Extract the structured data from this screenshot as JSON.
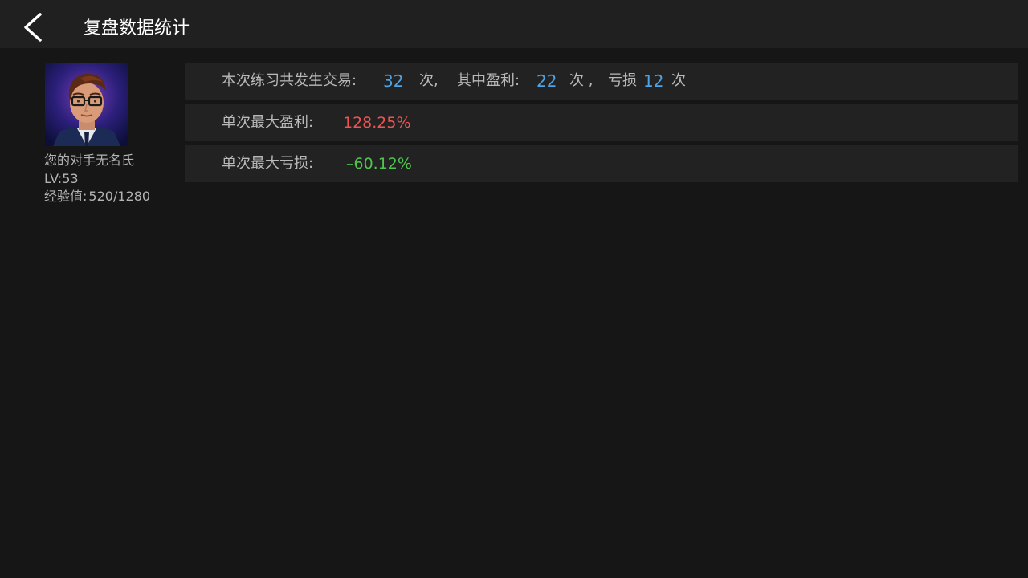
{
  "header": {
    "title": "复盘数据统计"
  },
  "player": {
    "name": "您的对手无名氏",
    "level": "LV:53",
    "exp_label": "经验值:",
    "exp_value": "520/1280"
  },
  "stats": {
    "trades_label": "本次练习共发生交易:",
    "trades_count": "32",
    "times_unit": "次,",
    "profit_label": "其中盈利:",
    "profit_count": "22",
    "times_unit2": "次 ,",
    "loss_label": "亏损",
    "loss_count": "12",
    "times_unit3": "次",
    "max_profit_label": "单次最大盈利:",
    "max_profit_value": "128.25%",
    "max_loss_label": "单次最大亏损:",
    "max_loss_value": "–60.12%"
  },
  "colors": {
    "count_color": "#4ea3e5",
    "profit_color": "#ee5454",
    "loss_color": "#4ec64e"
  },
  "icons": {
    "back": "chevron-left-icon",
    "avatar": "avatar-portrait"
  }
}
